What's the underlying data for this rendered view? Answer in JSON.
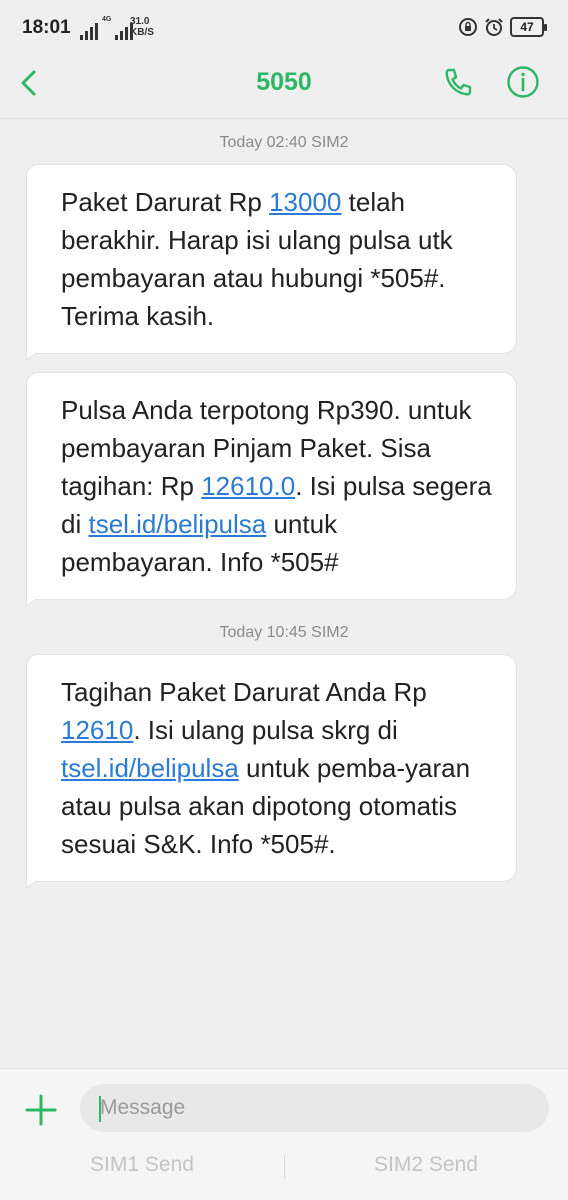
{
  "status_bar": {
    "time": "18:01",
    "network_type": "4G",
    "speed_value": "31.0",
    "speed_unit": "KB/S",
    "battery": "47",
    "icons": [
      "signal-icon",
      "signal-icon",
      "lock-rotation-icon",
      "alarm-icon",
      "battery-icon"
    ]
  },
  "header": {
    "title": "5050",
    "icons": [
      "back-arrow-icon",
      "phone-icon",
      "info-icon"
    ],
    "accent_color": "#2db665"
  },
  "conversation": {
    "groups": [
      {
        "timestamp": "Today 02:40  SIM2",
        "messages": [
          {
            "parts": [
              "Paket Darurat Rp ",
              "13000",
              " telah berakhir. Harap isi ulang pulsa utk pembayaran atau hubungi *505#. Terima kasih."
            ]
          },
          {
            "parts": [
              "Pulsa Anda terpotong Rp390. untuk pembayaran Pinjam Paket. Sisa tagihan: Rp ",
              "12610.0",
              ". Isi pulsa segera di ",
              "tsel.id/belipulsa",
              " untuk pembayaran. Info *505#"
            ]
          }
        ]
      },
      {
        "timestamp": "Today 10:45  SIM2",
        "messages": [
          {
            "parts": [
              "Tagihan Paket Darurat Anda Rp ",
              "12610",
              ". Isi ulang pulsa skrg di ",
              "tsel.id/belipulsa",
              " untuk pemba-yaran atau pulsa akan dipotong otomatis sesuai S&K. Info *505#."
            ]
          }
        ]
      }
    ],
    "link_color": "#2b7bd6"
  },
  "composer": {
    "placeholder": "Message",
    "sim1_send": "SIM1 Send",
    "sim2_send": "SIM2 Send",
    "icons": [
      "plus-icon"
    ]
  }
}
